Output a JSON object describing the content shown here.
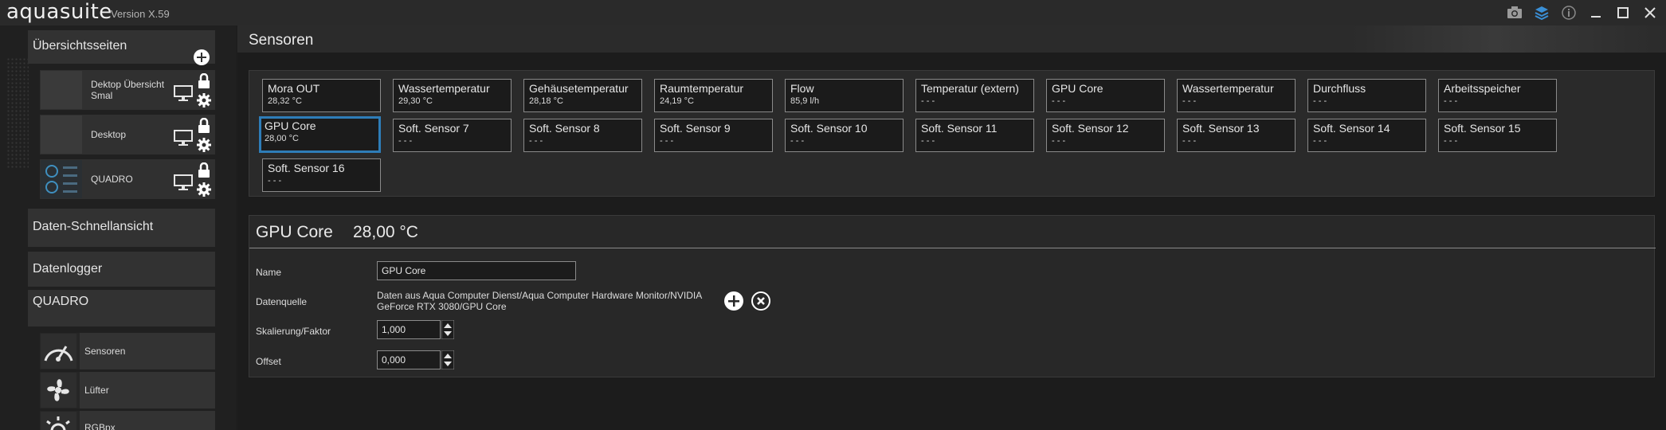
{
  "app": {
    "name": "aquasuite",
    "version": "Version X.59"
  },
  "titlebar_icons": [
    "camera-icon",
    "layers-icon",
    "info-icon",
    "minimize-icon",
    "maximize-icon",
    "close-icon"
  ],
  "sidebar": {
    "overview_pages": {
      "label": "Übersichtsseiten",
      "pages": [
        {
          "label": "Dektop Übersicht Smal"
        },
        {
          "label": "Desktop"
        },
        {
          "label": "QUADRO"
        }
      ]
    },
    "quick_view": "Daten-Schnellansicht",
    "datalogger": "Datenlogger",
    "device": {
      "label": "QUADRO",
      "items": [
        {
          "label": "Sensoren"
        },
        {
          "label": "Lüfter"
        },
        {
          "label": "RGBpx"
        }
      ]
    }
  },
  "main": {
    "title": "Sensoren",
    "tiles": [
      {
        "name": "Mora OUT",
        "value": "28,32 °C"
      },
      {
        "name": "Wassertemperatur",
        "value": "29,30 °C"
      },
      {
        "name": "Gehäusetemperatur",
        "value": "28,18 °C"
      },
      {
        "name": "Raumtemperatur",
        "value": "24,19 °C"
      },
      {
        "name": "Flow",
        "value": "85,9 l/h"
      },
      {
        "name": "Temperatur (extern)",
        "value": "- - -"
      },
      {
        "name": "GPU Core",
        "value": "- - -"
      },
      {
        "name": "Wassertemperatur",
        "value": "- - -"
      },
      {
        "name": "Durchfluss",
        "value": "- - -"
      },
      {
        "name": "Arbeitsspeicher",
        "value": "- - -"
      },
      {
        "name": "GPU Core",
        "value": "28,00 °C",
        "selected": true
      },
      {
        "name": "Soft. Sensor 7",
        "value": "- - -"
      },
      {
        "name": "Soft. Sensor 8",
        "value": "- - -"
      },
      {
        "name": "Soft. Sensor 9",
        "value": "- - -"
      },
      {
        "name": "Soft. Sensor 10",
        "value": "- - -"
      },
      {
        "name": "Soft. Sensor 11",
        "value": "- - -"
      },
      {
        "name": "Soft. Sensor 12",
        "value": "- - -"
      },
      {
        "name": "Soft. Sensor 13",
        "value": "- - -"
      },
      {
        "name": "Soft. Sensor 14",
        "value": "- - -"
      },
      {
        "name": "Soft. Sensor 15",
        "value": "- - -"
      },
      {
        "name": "Soft. Sensor 16",
        "value": "- - -"
      }
    ],
    "detail": {
      "title": "GPU Core",
      "value": "28,00 °C",
      "name_label": "Name",
      "name_value": "GPU Core",
      "source_label": "Datenquelle",
      "source_value": "Daten aus Aqua Computer Dienst/Aqua Computer Hardware Monitor/NVIDIA GeForce RTX 3080/GPU Core",
      "scale_label": "Skalierung/Faktor",
      "scale_value": "1,000",
      "offset_label": "Offset",
      "offset_value": "0,000"
    }
  },
  "colors": {
    "accent": "#2e7db8",
    "bg": "#1e1e1e",
    "panel": "#2a2a2a"
  }
}
